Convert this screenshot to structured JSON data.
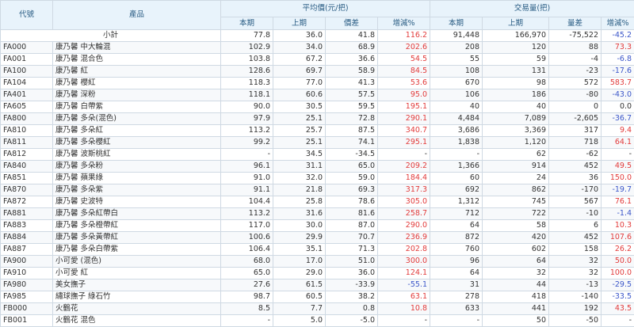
{
  "header": {
    "code": "代號",
    "product": "產品",
    "group_price": "平均價(元/把)",
    "group_volume": "交易量(把)",
    "current": "本期",
    "previous": "上期",
    "price_diff": "價差",
    "change_pct": "增減%",
    "volume_diff": "量差"
  },
  "subtotal": {
    "label": "小計",
    "p_cur": "77.8",
    "p_prev": "36.0",
    "p_diff": "41.8",
    "p_pct": "116.2",
    "p_pct_color": "red",
    "v_cur": "91,448",
    "v_prev": "166,970",
    "v_diff": "-75,522",
    "v_pct": "-45.2",
    "v_pct_color": "blue"
  },
  "rows": [
    {
      "code": "FA000",
      "name": "康乃馨 中大輪混",
      "p_cur": "102.9",
      "p_prev": "34.0",
      "p_diff": "68.9",
      "p_pct": "202.6",
      "p_pct_color": "red",
      "v_cur": "208",
      "v_prev": "120",
      "v_diff": "88",
      "v_pct": "73.3",
      "v_pct_color": "red"
    },
    {
      "code": "FA001",
      "name": "康乃馨 混合色",
      "p_cur": "103.8",
      "p_prev": "67.2",
      "p_diff": "36.6",
      "p_pct": "54.5",
      "p_pct_color": "red",
      "v_cur": "55",
      "v_prev": "59",
      "v_diff": "-4",
      "v_pct": "-6.8",
      "v_pct_color": "blue"
    },
    {
      "code": "FA100",
      "name": "康乃馨 紅",
      "p_cur": "128.6",
      "p_prev": "69.7",
      "p_diff": "58.9",
      "p_pct": "84.5",
      "p_pct_color": "red",
      "v_cur": "108",
      "v_prev": "131",
      "v_diff": "-23",
      "v_pct": "-17.6",
      "v_pct_color": "blue"
    },
    {
      "code": "FA104",
      "name": "康乃馨 櫻紅",
      "p_cur": "118.3",
      "p_prev": "77.0",
      "p_diff": "41.3",
      "p_pct": "53.6",
      "p_pct_color": "red",
      "v_cur": "670",
      "v_prev": "98",
      "v_diff": "572",
      "v_pct": "583.7",
      "v_pct_color": "red"
    },
    {
      "code": "FA401",
      "name": "康乃馨 深粉",
      "p_cur": "118.1",
      "p_prev": "60.6",
      "p_diff": "57.5",
      "p_pct": "95.0",
      "p_pct_color": "red",
      "v_cur": "106",
      "v_prev": "186",
      "v_diff": "-80",
      "v_pct": "-43.0",
      "v_pct_color": "blue"
    },
    {
      "code": "FA605",
      "name": "康乃馨 白帶紫",
      "p_cur": "90.0",
      "p_prev": "30.5",
      "p_diff": "59.5",
      "p_pct": "195.1",
      "p_pct_color": "red",
      "v_cur": "40",
      "v_prev": "40",
      "v_diff": "0",
      "v_pct": "0.0",
      "v_pct_color": ""
    },
    {
      "code": "FA800",
      "name": "康乃馨 多朵(混色)",
      "p_cur": "97.9",
      "p_prev": "25.1",
      "p_diff": "72.8",
      "p_pct": "290.1",
      "p_pct_color": "red",
      "v_cur": "4,484",
      "v_prev": "7,089",
      "v_diff": "-2,605",
      "v_pct": "-36.7",
      "v_pct_color": "blue"
    },
    {
      "code": "FA810",
      "name": "康乃馨 多朵紅",
      "p_cur": "113.2",
      "p_prev": "25.7",
      "p_diff": "87.5",
      "p_pct": "340.7",
      "p_pct_color": "red",
      "v_cur": "3,686",
      "v_prev": "3,369",
      "v_diff": "317",
      "v_pct": "9.4",
      "v_pct_color": "red"
    },
    {
      "code": "FA811",
      "name": "康乃馨 多朵櫻紅",
      "p_cur": "99.2",
      "p_prev": "25.1",
      "p_diff": "74.1",
      "p_pct": "295.1",
      "p_pct_color": "red",
      "v_cur": "1,838",
      "v_prev": "1,120",
      "v_diff": "718",
      "v_pct": "64.1",
      "v_pct_color": "red"
    },
    {
      "code": "FA812",
      "name": "康乃馨 波斯桃紅",
      "p_cur": "-",
      "p_prev": "34.5",
      "p_diff": "-34.5",
      "p_pct": "-",
      "p_pct_color": "",
      "v_cur": "-",
      "v_prev": "62",
      "v_diff": "-62",
      "v_pct": "-",
      "v_pct_color": ""
    },
    {
      "code": "FA840",
      "name": "康乃馨 多朵粉",
      "p_cur": "96.1",
      "p_prev": "31.1",
      "p_diff": "65.0",
      "p_pct": "209.2",
      "p_pct_color": "red",
      "v_cur": "1,366",
      "v_prev": "914",
      "v_diff": "452",
      "v_pct": "49.5",
      "v_pct_color": "red"
    },
    {
      "code": "FA851",
      "name": "康乃馨 蘋果綠",
      "p_cur": "91.0",
      "p_prev": "32.0",
      "p_diff": "59.0",
      "p_pct": "184.4",
      "p_pct_color": "red",
      "v_cur": "60",
      "v_prev": "24",
      "v_diff": "36",
      "v_pct": "150.0",
      "v_pct_color": "red"
    },
    {
      "code": "FA870",
      "name": "康乃馨 多朵紫",
      "p_cur": "91.1",
      "p_prev": "21.8",
      "p_diff": "69.3",
      "p_pct": "317.3",
      "p_pct_color": "red",
      "v_cur": "692",
      "v_prev": "862",
      "v_diff": "-170",
      "v_pct": "-19.7",
      "v_pct_color": "blue"
    },
    {
      "code": "FA872",
      "name": "康乃馨 史波特",
      "p_cur": "104.4",
      "p_prev": "25.8",
      "p_diff": "78.6",
      "p_pct": "305.0",
      "p_pct_color": "red",
      "v_cur": "1,312",
      "v_prev": "745",
      "v_diff": "567",
      "v_pct": "76.1",
      "v_pct_color": "red"
    },
    {
      "code": "FA881",
      "name": "康乃馨 多朵紅帶白",
      "p_cur": "113.2",
      "p_prev": "31.6",
      "p_diff": "81.6",
      "p_pct": "258.7",
      "p_pct_color": "red",
      "v_cur": "712",
      "v_prev": "722",
      "v_diff": "-10",
      "v_pct": "-1.4",
      "v_pct_color": "blue"
    },
    {
      "code": "FA883",
      "name": "康乃馨 多朵橙帶紅",
      "p_cur": "117.0",
      "p_prev": "30.0",
      "p_diff": "87.0",
      "p_pct": "290.0",
      "p_pct_color": "red",
      "v_cur": "64",
      "v_prev": "58",
      "v_diff": "6",
      "v_pct": "10.3",
      "v_pct_color": "red"
    },
    {
      "code": "FA884",
      "name": "康乃馨 多朵黃帶紅",
      "p_cur": "100.6",
      "p_prev": "29.9",
      "p_diff": "70.7",
      "p_pct": "236.9",
      "p_pct_color": "red",
      "v_cur": "872",
      "v_prev": "420",
      "v_diff": "452",
      "v_pct": "107.6",
      "v_pct_color": "red"
    },
    {
      "code": "FA887",
      "name": "康乃馨 多朵白帶紫",
      "p_cur": "106.4",
      "p_prev": "35.1",
      "p_diff": "71.3",
      "p_pct": "202.8",
      "p_pct_color": "red",
      "v_cur": "760",
      "v_prev": "602",
      "v_diff": "158",
      "v_pct": "26.2",
      "v_pct_color": "red"
    },
    {
      "code": "FA900",
      "name": "小可愛 (混色)",
      "p_cur": "68.0",
      "p_prev": "17.0",
      "p_diff": "51.0",
      "p_pct": "300.0",
      "p_pct_color": "red",
      "v_cur": "96",
      "v_prev": "64",
      "v_diff": "32",
      "v_pct": "50.0",
      "v_pct_color": "red"
    },
    {
      "code": "FA910",
      "name": "小可愛 紅",
      "p_cur": "65.0",
      "p_prev": "29.0",
      "p_diff": "36.0",
      "p_pct": "124.1",
      "p_pct_color": "red",
      "v_cur": "64",
      "v_prev": "32",
      "v_diff": "32",
      "v_pct": "100.0",
      "v_pct_color": "red"
    },
    {
      "code": "FA980",
      "name": "美女撫子",
      "p_cur": "27.6",
      "p_prev": "61.5",
      "p_diff": "-33.9",
      "p_pct": "-55.1",
      "p_pct_color": "blue",
      "v_cur": "31",
      "v_prev": "44",
      "v_diff": "-13",
      "v_pct": "-29.5",
      "v_pct_color": "blue"
    },
    {
      "code": "FA985",
      "name": "繡球撫子 綠石竹",
      "p_cur": "98.7",
      "p_prev": "60.5",
      "p_diff": "38.2",
      "p_pct": "63.1",
      "p_pct_color": "red",
      "v_cur": "278",
      "v_prev": "418",
      "v_diff": "-140",
      "v_pct": "-33.5",
      "v_pct_color": "blue"
    },
    {
      "code": "FB000",
      "name": "火鶴花",
      "p_cur": "8.5",
      "p_prev": "7.7",
      "p_diff": "0.8",
      "p_pct": "10.8",
      "p_pct_color": "red",
      "v_cur": "633",
      "v_prev": "441",
      "v_diff": "192",
      "v_pct": "43.5",
      "v_pct_color": "red"
    },
    {
      "code": "FB001",
      "name": "火鶴花 混色",
      "p_cur": "-",
      "p_prev": "5.0",
      "p_diff": "-5.0",
      "p_pct": "-",
      "p_pct_color": "",
      "v_cur": "-",
      "v_prev": "50",
      "v_diff": "-50",
      "v_pct": "-",
      "v_pct_color": ""
    }
  ]
}
